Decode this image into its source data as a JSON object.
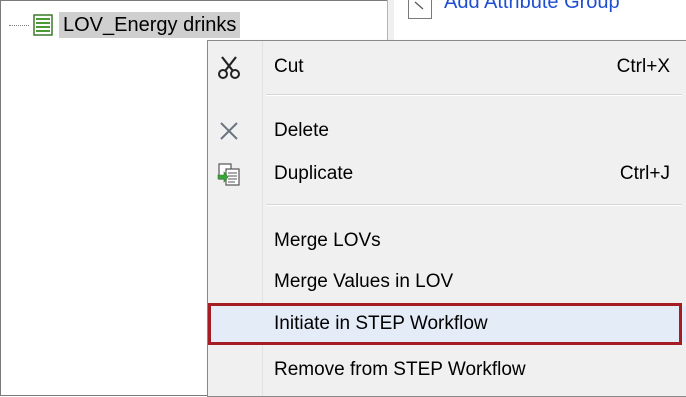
{
  "tree": {
    "node_label": "LOV_Energy drinks",
    "node_icon": "list-of-values-icon"
  },
  "right_pane": {
    "link_label": "Add Attribute Group",
    "link_icon": "attribute-group-icon"
  },
  "context_menu": {
    "items": [
      {
        "label": "Cut",
        "shortcut": "Ctrl+X",
        "icon": "scissors-icon"
      },
      {
        "label": "Delete",
        "shortcut": "",
        "icon": "delete-x-icon"
      },
      {
        "label": "Duplicate",
        "shortcut": "Ctrl+J",
        "icon": "duplicate-icon"
      },
      {
        "label": "Merge LOVs",
        "shortcut": "",
        "icon": ""
      },
      {
        "label": "Merge Values in LOV",
        "shortcut": "",
        "icon": ""
      },
      {
        "label": "Initiate in STEP Workflow",
        "shortcut": "",
        "icon": ""
      },
      {
        "label": "Remove from STEP Workflow",
        "shortcut": "",
        "icon": ""
      }
    ],
    "highlighted_item": "Initiate in STEP Workflow",
    "highlight_color": "#a51c24"
  }
}
